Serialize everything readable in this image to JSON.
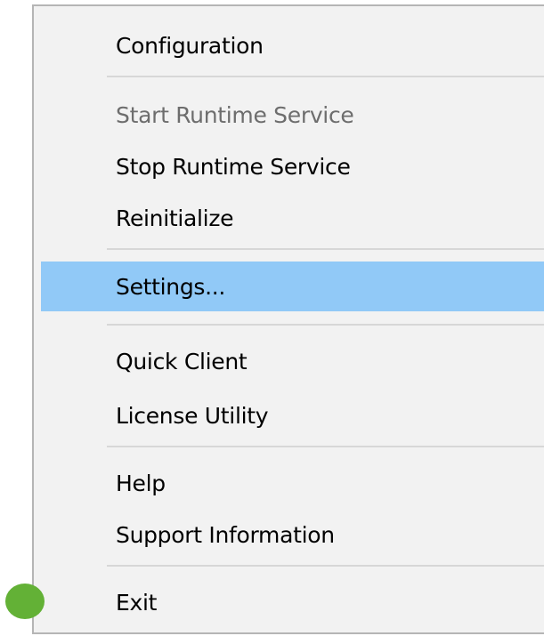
{
  "menu": {
    "items": [
      {
        "label": "Configuration",
        "disabled": false,
        "selected": false
      },
      {
        "label": "Start Runtime Service",
        "disabled": true,
        "selected": false
      },
      {
        "label": "Stop Runtime Service",
        "disabled": false,
        "selected": false
      },
      {
        "label": "Reinitialize",
        "disabled": false,
        "selected": false
      },
      {
        "label": "Settings...",
        "disabled": false,
        "selected": true
      },
      {
        "label": "Quick Client",
        "disabled": false,
        "selected": false
      },
      {
        "label": "License Utility",
        "disabled": false,
        "selected": false
      },
      {
        "label": "Help",
        "disabled": false,
        "selected": false
      },
      {
        "label": "Support Information",
        "disabled": false,
        "selected": false
      },
      {
        "label": "Exit",
        "disabled": false,
        "selected": false
      }
    ]
  },
  "colors": {
    "menu_background": "#f2f2f2",
    "menu_border": "#b5b5b5",
    "highlight": "#91c9f7",
    "disabled_text": "#6d6d6d",
    "separator": "#d7d7d7",
    "tray_icon": "#63b136"
  },
  "tray": {
    "icon": "green-status-dot-icon"
  }
}
